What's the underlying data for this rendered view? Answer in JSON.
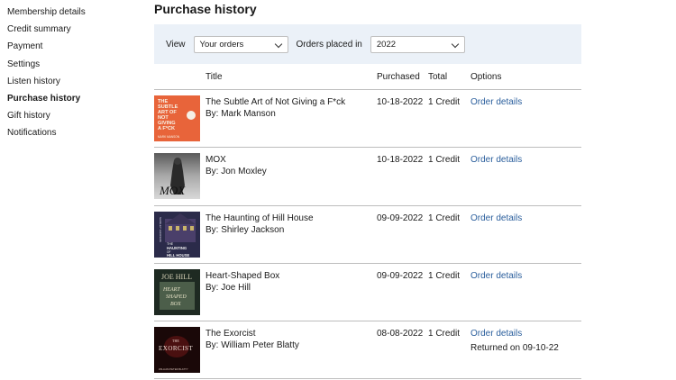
{
  "sidebar": {
    "items": [
      {
        "label": "Membership details"
      },
      {
        "label": "Credit summary"
      },
      {
        "label": "Payment"
      },
      {
        "label": "Settings"
      },
      {
        "label": "Listen history"
      },
      {
        "label": "Purchase history",
        "active": true
      },
      {
        "label": "Gift history"
      },
      {
        "label": "Notifications"
      }
    ]
  },
  "main": {
    "title": "Purchase history",
    "filters": {
      "view_label": "View",
      "view_value": "Your orders",
      "placed_label": "Orders placed in",
      "placed_value": "2022"
    },
    "table": {
      "headers": {
        "title": "Title",
        "purchased": "Purchased",
        "total": "Total",
        "options": "Options"
      },
      "rows": [
        {
          "title": "The Subtle Art of Not Giving a F*ck",
          "author": "By: Mark Manson",
          "purchased": "10-18-2022",
          "total": "1 Credit",
          "link": "Order details",
          "returned": ""
        },
        {
          "title": "MOX",
          "author": "By: Jon Moxley",
          "purchased": "10-18-2022",
          "total": "1 Credit",
          "link": "Order details",
          "returned": ""
        },
        {
          "title": "The Haunting of Hill House",
          "author": "By: Shirley Jackson",
          "purchased": "09-09-2022",
          "total": "1 Credit",
          "link": "Order details",
          "returned": ""
        },
        {
          "title": "Heart-Shaped Box",
          "author": "By: Joe Hill",
          "purchased": "09-09-2022",
          "total": "1 Credit",
          "link": "Order details",
          "returned": ""
        },
        {
          "title": "The Exorcist",
          "author": "By: William Peter Blatty",
          "purchased": "08-08-2022",
          "total": "1 Credit",
          "link": "Order details",
          "returned": "Returned on 09-10-22"
        }
      ]
    }
  },
  "covers": [
    {
      "name": "subtle-art-cover",
      "text_lines": [
        "THE",
        "SUBTLE",
        "ART OF",
        "NOT",
        "GIVING",
        "A F*CK"
      ],
      "byline": "MARK MANSON",
      "bg": "#e8643a"
    },
    {
      "name": "mox-cover",
      "text": "MOX",
      "bg": "#8a8a8a"
    },
    {
      "name": "haunting-cover",
      "text_lines": [
        "THE",
        "HAUNTING",
        "OF",
        "HILL HOUSE"
      ],
      "side_text": "SHIRLEY JACKSON",
      "bg": "#2b2b4a"
    },
    {
      "name": "heart-shaped-box-cover",
      "top_text": "JOE HILL",
      "text_lines": [
        "HEART",
        "SHAPED",
        "BOX"
      ],
      "bg": "#1e2a22"
    },
    {
      "name": "exorcist-cover",
      "text_lines": [
        "THE",
        "EXORCIST"
      ],
      "byline": "WILLIAM PETER BLATTY",
      "bg": "#1a0808"
    }
  ],
  "colors": {
    "link": "#2a5e9c",
    "filter_bg": "#ebf1f8",
    "divider": "#bdbdbd"
  }
}
